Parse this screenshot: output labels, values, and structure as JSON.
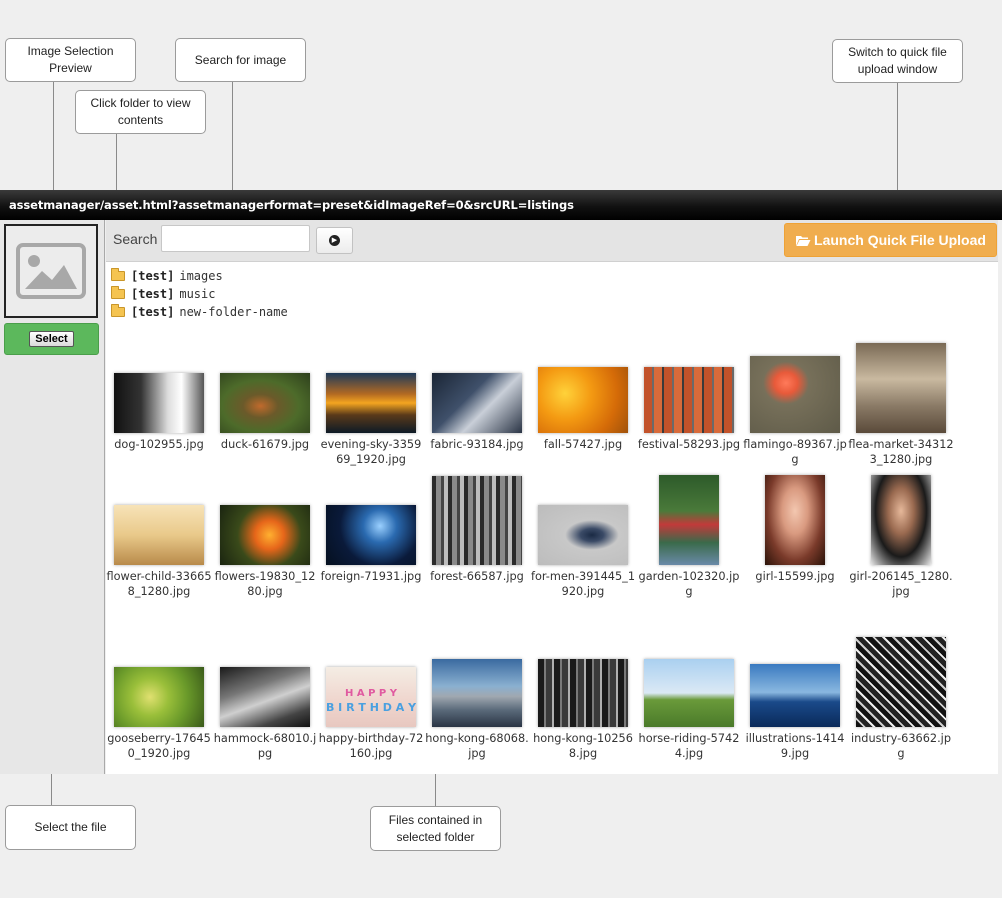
{
  "callouts": {
    "image_selection_preview": "Image Selection Preview",
    "search_for_image": "Search for image",
    "click_folder": "Click folder to view contents",
    "switch_upload": "Switch to quick file upload window",
    "select_file": "Select the file",
    "files_contained": "Files contained in selected folder"
  },
  "window": {
    "title": "assetmanager/asset.html?assetmanagerformat=preset&idImageRef=0&srcURL=listings"
  },
  "sidebar": {
    "preview_icon": "image-placeholder-icon",
    "select_label": "Select"
  },
  "toolbar": {
    "search_label": "Search",
    "search_value": "",
    "go_icon": "circle-arrow-right-icon",
    "launch_label": "Launch Quick File Upload",
    "launch_icon": "folder-open-icon"
  },
  "folders": [
    {
      "tag": "[test]",
      "name": "images"
    },
    {
      "tag": "[test]",
      "name": "music"
    },
    {
      "tag": "[test]",
      "name": "new-folder-name"
    }
  ],
  "files": [
    {
      "name": "dog-102955.jpg"
    },
    {
      "name": "duck-61679.jpg"
    },
    {
      "name": "evening-sky-335969_1920.jpg"
    },
    {
      "name": "fabric-93184.jpg"
    },
    {
      "name": "fall-57427.jpg"
    },
    {
      "name": "festival-58293.jpg"
    },
    {
      "name": "flamingo-89367.jpg"
    },
    {
      "name": "flea-market-343123_1280.jpg"
    },
    {
      "name": "flower-child-336658_1280.jpg"
    },
    {
      "name": "flowers-19830_1280.jpg"
    },
    {
      "name": "foreign-71931.jpg"
    },
    {
      "name": "forest-66587.jpg"
    },
    {
      "name": "for-men-391445_1920.jpg"
    },
    {
      "name": "garden-102320.jpg"
    },
    {
      "name": "girl-15599.jpg"
    },
    {
      "name": "girl-206145_1280.jpg"
    },
    {
      "name": "gooseberry-176450_1920.jpg"
    },
    {
      "name": "hammock-68010.jpg"
    },
    {
      "name": "happy-birthday-72160.jpg"
    },
    {
      "name": "hong-kong-68068.jpg"
    },
    {
      "name": "hong-kong-102568.jpg"
    },
    {
      "name": "horse-riding-57424.jpg"
    },
    {
      "name": "illustrations-14149.jpg"
    },
    {
      "name": "industry-63662.jpg"
    }
  ]
}
